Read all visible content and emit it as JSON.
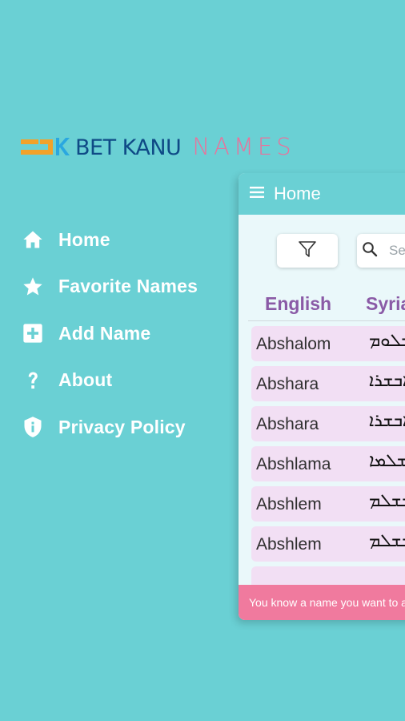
{
  "logo": {
    "brand": "BET KANU",
    "product": "NAMES"
  },
  "menu": [
    {
      "label": "Home",
      "icon": "home-icon"
    },
    {
      "label": "Favorite Names",
      "icon": "star-icon"
    },
    {
      "label": "Add Name",
      "icon": "add-box-icon"
    },
    {
      "label": "About",
      "icon": "question-icon"
    },
    {
      "label": "Privacy Policy",
      "icon": "shield-icon"
    }
  ],
  "appbar": {
    "title": "Home"
  },
  "search": {
    "placeholder": "Se"
  },
  "table": {
    "headers": {
      "english": "English",
      "syriac": "Syria"
    },
    "rows": [
      {
        "english": "Abshalom",
        "syriac": "ܐܒܫܠܘܡ"
      },
      {
        "english": "Abshara",
        "syriac": "ܐܒܫܪܐ"
      },
      {
        "english": "Abshara",
        "syriac": "ܐܒܫܪܐ"
      },
      {
        "english": "Abshlama",
        "syriac": "ܐܒܫܠܡܐ"
      },
      {
        "english": "Abshlem",
        "syriac": "ܐܒܫܠܡ"
      },
      {
        "english": "Abshlem",
        "syriac": "ܐܒܫܠܡ"
      },
      {
        "english": "",
        "syriac": ""
      }
    ]
  },
  "footer": {
    "text": "You know a name you want to add?"
  },
  "colors": {
    "background": "#6ad0d4",
    "brand_blue": "#0f4a86",
    "brand_pink": "#e8739c",
    "row_bg": "#f2dff4",
    "header_purple": "#8a5aa6",
    "footer_pink": "#f07a9e"
  }
}
